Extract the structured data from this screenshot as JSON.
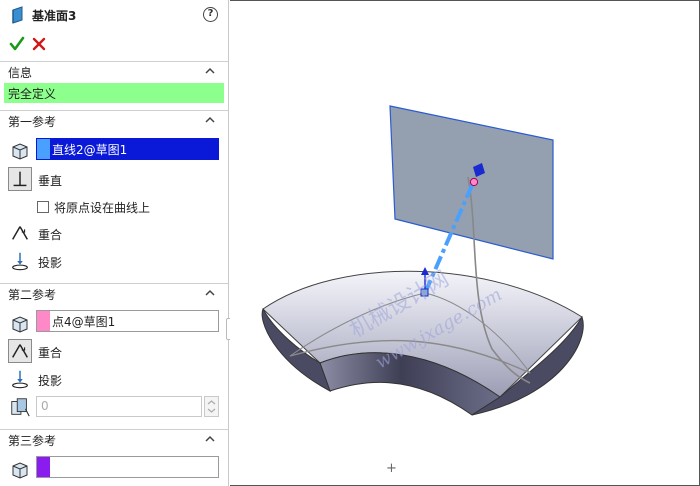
{
  "property_manager": {
    "title": "基准面3",
    "help_glyph": "?",
    "info_section": {
      "label": "信息",
      "status_text": "完全定义",
      "status_color": "#8cff8c"
    },
    "first_reference": {
      "label": "第一参考",
      "selection": "直线2@草图1",
      "selection_color": "#0a18d8",
      "options": {
        "perpendicular": "垂直",
        "origin_on_curve": "将原点设在曲线上",
        "coincident": "重合",
        "projection": "投影"
      }
    },
    "second_reference": {
      "label": "第二参考",
      "selection": "点4@草图1",
      "selection_color": "#ff88c8",
      "options": {
        "coincident": "重合",
        "projection": "投影"
      },
      "count_value": "0"
    },
    "third_reference": {
      "label": "第三参考",
      "selection": "",
      "selection_color": "#8a1cf0"
    }
  },
  "viewport": {
    "watermark_cn": "机械设计网",
    "watermark_url": "www.jxage.com",
    "cursor_glyph": "+"
  }
}
